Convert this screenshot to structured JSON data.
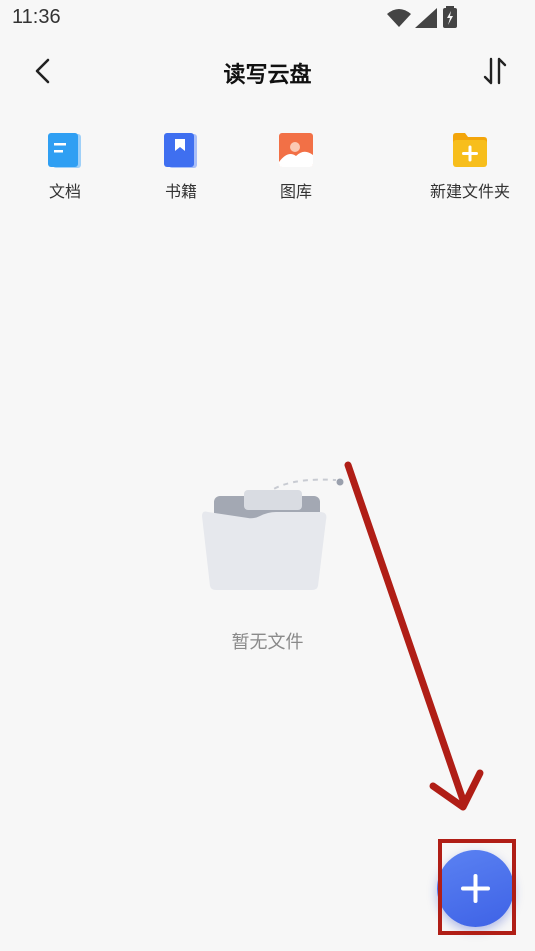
{
  "status_bar": {
    "time": "11:36"
  },
  "header": {
    "title": "读写云盘"
  },
  "shortcuts": [
    {
      "label": "文档",
      "icon": "document-icon",
      "color": "#2f9ff3"
    },
    {
      "label": "书籍",
      "icon": "book-icon",
      "color": "#3f6ff0"
    },
    {
      "label": "图库",
      "icon": "gallery-icon",
      "color": "#f27046"
    },
    {
      "label": "新建文件夹",
      "icon": "new-folder-icon",
      "color": "#f7be1c"
    }
  ],
  "empty_state": {
    "message": "暂无文件"
  },
  "fab": {
    "icon": "plus-icon"
  },
  "colors": {
    "annotation": "#b01e16",
    "fab": "#4a6ef0"
  }
}
